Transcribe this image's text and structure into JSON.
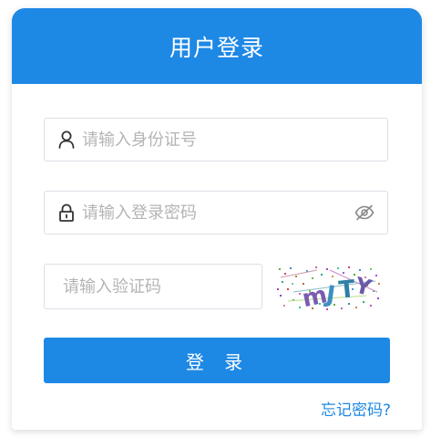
{
  "header": {
    "title": "用户登录"
  },
  "form": {
    "id_placeholder": "请输入身份证号",
    "password_placeholder": "请输入登录密码",
    "captcha_placeholder": "请输入验证码",
    "captcha_text": "mJTY",
    "login_label": "登 录",
    "forgot_label": "忘记密码?"
  },
  "icons": {
    "user": "user-icon",
    "lock": "lock-icon",
    "eye": "eye-off-icon"
  },
  "colors": {
    "primary": "#1e88e5",
    "border": "#dcdfe6",
    "placeholder": "#b4b4b4"
  }
}
